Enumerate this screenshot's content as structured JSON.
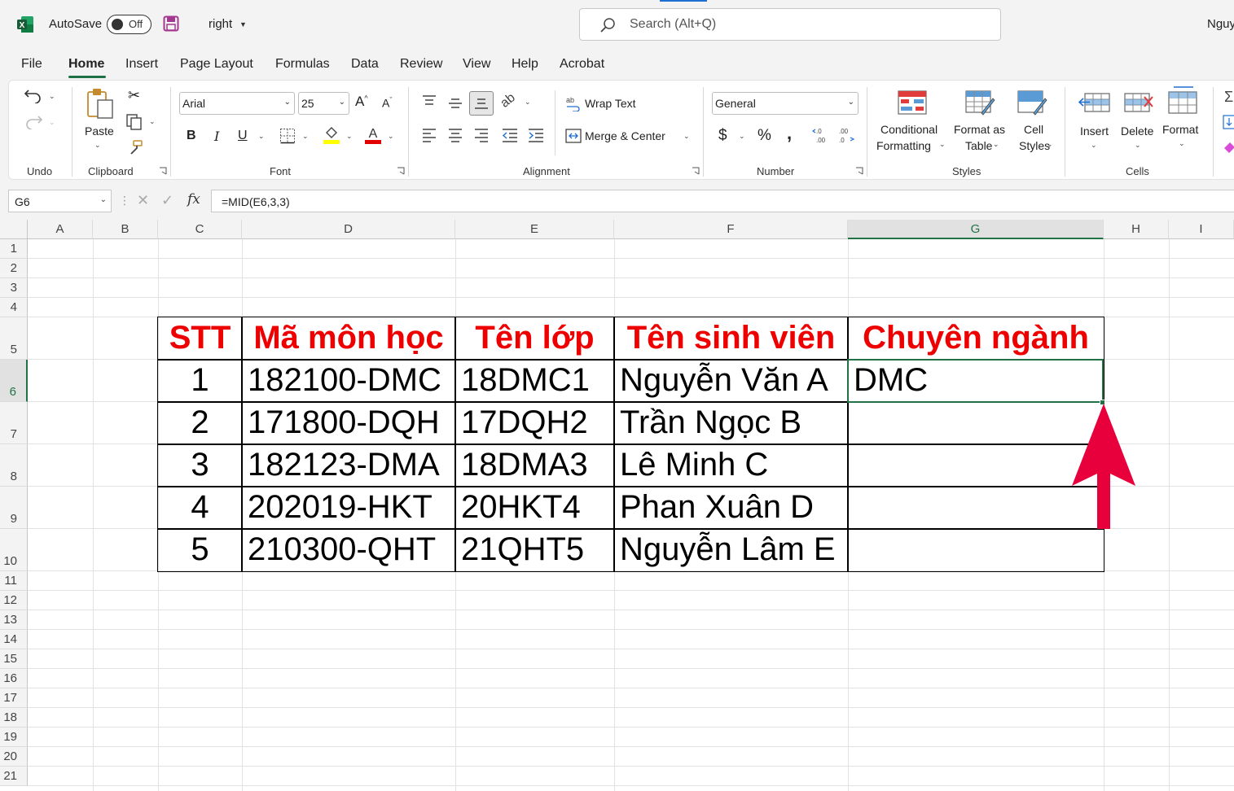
{
  "titlebar": {
    "autosave_label": "AutoSave",
    "autosave_state": "Off",
    "filename": "right",
    "search_placeholder": "Search (Alt+Q)",
    "user": "Nguy"
  },
  "tabs": [
    "File",
    "Home",
    "Insert",
    "Page Layout",
    "Formulas",
    "Data",
    "Review",
    "View",
    "Help",
    "Acrobat"
  ],
  "active_tab": "Home",
  "ribbon": {
    "groups": {
      "undo": "Undo",
      "clipboard": "Clipboard",
      "font": "Font",
      "alignment": "Alignment",
      "number": "Number",
      "styles": "Styles",
      "cells": "Cells"
    },
    "paste_label": "Paste",
    "font_name": "Arial",
    "font_size": "25",
    "bold": "B",
    "italic": "I",
    "underline": "U",
    "wrap_text": "Wrap Text",
    "merge_center": "Merge & Center",
    "number_format": "General",
    "currency_symbol": "$",
    "percent_symbol": "%",
    "comma_symbol": "̹",
    "conditional_formatting": [
      "Conditional",
      "Formatting"
    ],
    "format_as_table": [
      "Format as",
      "Table"
    ],
    "cell_styles": [
      "Cell",
      "Styles"
    ],
    "insert": "Insert",
    "delete": "Delete",
    "format": "Format"
  },
  "formula_bar": {
    "name_box": "G6",
    "formula": "=MID(E6,3,3)"
  },
  "columns": [
    "A",
    "B",
    "C",
    "D",
    "E",
    "F",
    "G",
    "H",
    "I"
  ],
  "rows": [
    "1",
    "2",
    "3",
    "4",
    "5",
    "6",
    "7",
    "8",
    "9",
    "10",
    "11",
    "12",
    "13",
    "14",
    "15",
    "16",
    "17",
    "18",
    "19",
    "20",
    "21"
  ],
  "selected_cell": "G6",
  "table": {
    "headers": [
      "STT",
      "Mã môn học",
      "Tên lớp",
      "Tên sinh viên",
      "Chuyên ngành"
    ],
    "rows": [
      [
        "1",
        "182100-DMC",
        "18DMC1",
        "Nguyễn Văn A",
        "DMC"
      ],
      [
        "2",
        "171800-DQH",
        "17DQH2",
        "Trần Ngọc B",
        ""
      ],
      [
        "3",
        "182123-DMA",
        "18DMA3",
        "Lê Minh C",
        ""
      ],
      [
        "4",
        "202019-HKT",
        "20HKT4",
        "Phan Xuân D",
        ""
      ],
      [
        "5",
        "210300-QHT",
        "21QHT5",
        "Nguyễn Lâm E",
        ""
      ]
    ]
  },
  "colors": {
    "excel_green": "#217346",
    "header_text": "#ee0000",
    "arrow": "#e8003d",
    "font_color_bar": "#e00000",
    "highlight_bar": "#ffff00"
  }
}
